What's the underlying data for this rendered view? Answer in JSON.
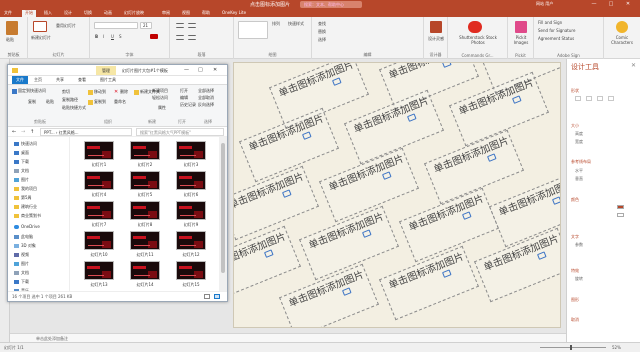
{
  "titlebar": {
    "doc_title": "点击图标添加图片",
    "search_placeholder": "搜索：文本、帮助中心",
    "user": "网站 用户",
    "minimize": "—",
    "maximize": "□",
    "close": "✕"
  },
  "tabs": [
    "文件",
    "开始",
    "插入",
    "设计",
    "切换",
    "动画",
    "幻灯片放映",
    "审阅",
    "视图",
    "帮助",
    "OneKey Lite"
  ],
  "ribbon": {
    "groups": [
      "剪贴板",
      "幻灯片",
      "字体",
      "段落",
      "绘图",
      "编辑",
      "设计器",
      "Commands Gr...",
      "Pickit",
      "Adobe Sign"
    ],
    "buttons": {
      "paste": "粘贴",
      "new_slide": "新建幻灯片",
      "reuse": "重用幻灯片",
      "font_size": "21",
      "shapes": "形状",
      "arrange": "排列",
      "quick_styles": "快速样式",
      "find": "查找",
      "replace": "替换",
      "select": "选择",
      "design_ideas": "设计灵感",
      "shutterstock": "Shutterstock Stock Photos",
      "pickit": "Pickit Images",
      "fill_sign": "Fill and Sign",
      "send_sig": "Send for Signature",
      "agreement": "Agreement Status",
      "comic": "Comic Characters"
    }
  },
  "slide": {
    "placeholder_text": "单击图标添加图片"
  },
  "notes": {
    "placeholder": "单击此处添加备注"
  },
  "status": {
    "left": "幻灯片 1/1",
    "zoom": "52%"
  },
  "design_pane": {
    "title": "设计工具",
    "sections": [
      "形状",
      "大小",
      "参考线布局",
      "颜色",
      "文字",
      "特效",
      "图形",
      "取消"
    ],
    "subitems": [
      "高度",
      "宽度",
      "水平",
      "垂直",
      "参数",
      "旋转"
    ]
  },
  "explorer": {
    "title": "幻灯片图片大包#1个模板",
    "tabs": [
      "文件",
      "主页",
      "共享",
      "查看",
      "图片工具"
    ],
    "manage_tab": "管理",
    "ribbon": {
      "pin": "固定到快速访问",
      "copy": "复制",
      "paste": "粘贴",
      "cut": "剪切",
      "copy_path": "复制路径",
      "paste_shortcut": "粘贴快捷方式",
      "move_to": "移动到",
      "copy_to": "复制到",
      "delete": "删除",
      "rename": "重命名",
      "new_folder": "新建文件夹",
      "new_item": "新建项目",
      "easy_access": "轻松访问",
      "properties": "属性",
      "open": "打开",
      "edit": "编辑",
      "history": "历史记录",
      "select_all": "全部选择",
      "select_none": "全部取消",
      "invert": "反向选择",
      "groups": [
        "剪贴板",
        "组织",
        "新建",
        "打开",
        "选择"
      ]
    },
    "address": "PPT... › 红黑风格...",
    "search": "搜索\"红黑风格大气PPT模板\"",
    "nav": [
      "快速访问",
      "桌面",
      "下载",
      "文档",
      "图片",
      "我的项目",
      "第5周",
      "建筑行业",
      "商业策划书",
      "OneDrive",
      "此电脑",
      "3D 对象",
      "视频",
      "图片",
      "文档",
      "下载",
      "音乐"
    ],
    "files": [
      "幻灯片1",
      "幻灯片2",
      "幻灯片3",
      "幻灯片4",
      "幻灯片5",
      "幻灯片6",
      "幻灯片7",
      "幻灯片8",
      "幻灯片9",
      "幻灯片10",
      "幻灯片11",
      "幻灯片12",
      "幻灯片13",
      "幻灯片14",
      "幻灯片15"
    ],
    "status": "16 个项目   选中 1 个项目 261 KB"
  }
}
